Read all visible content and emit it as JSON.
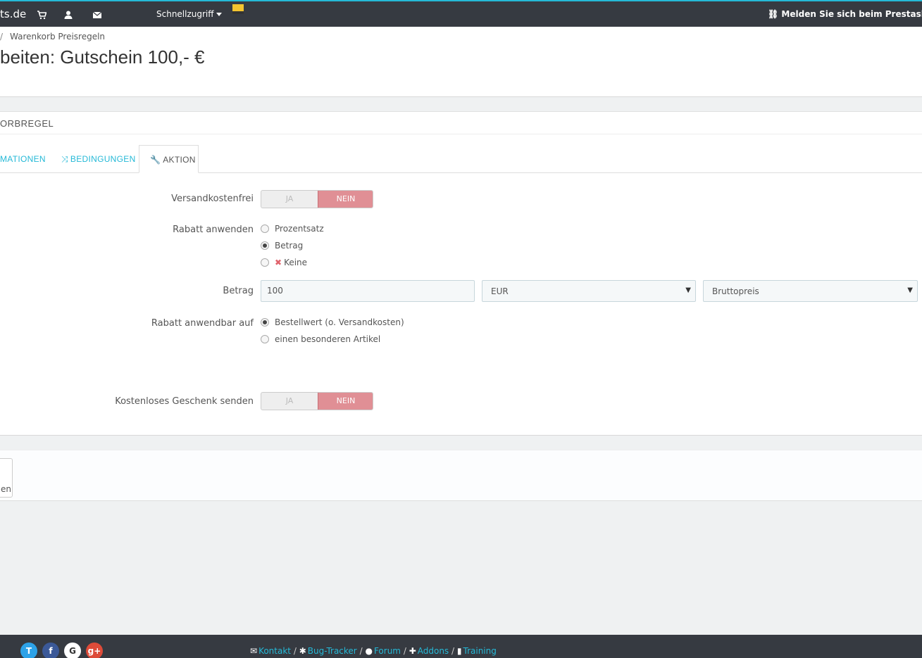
{
  "topbar": {
    "shop_name": "ts.de",
    "cart_icon": "shopping-cart-icon",
    "user_icon": "user-icon",
    "mail_icon": "envelope-icon",
    "quick_access": "Schnellzugriff",
    "login_notice": "Melden Sie sich beim Prestashop Ma"
  },
  "breadcrumb": {
    "separator": "/",
    "current": "Warenkorb Preisregeln"
  },
  "page_title": "beiten: Gutschein 100,- €",
  "panel": {
    "heading": "ORBREGEL",
    "tabs": [
      {
        "label": "MATIONEN",
        "icon": "info-icon"
      },
      {
        "label": "BEDINGUNGEN",
        "icon": "random-icon"
      },
      {
        "label": "AKTION",
        "icon": "wrench-icon"
      }
    ]
  },
  "form": {
    "free_shipping": {
      "label": "Versandkostenfrei",
      "yes": "JA",
      "no": "NEIN",
      "value": "NEIN"
    },
    "apply_discount": {
      "label": "Rabatt anwenden",
      "options": [
        {
          "label": "Prozentsatz",
          "checked": false
        },
        {
          "label": "Betrag",
          "checked": true
        },
        {
          "label": "Keine",
          "checked": false,
          "icon": "times-icon"
        }
      ]
    },
    "amount": {
      "label": "Betrag",
      "value": "100",
      "currency": "EUR",
      "tax": "Bruttopreis"
    },
    "apply_to": {
      "label": "Rabatt anwendbar auf",
      "options": [
        {
          "label": "Bestellwert (o. Versandkosten)",
          "checked": true
        },
        {
          "label": "einen besonderen Artikel",
          "checked": false
        }
      ]
    },
    "free_gift": {
      "label": "Kostenloses Geschenk senden",
      "yes": "JA",
      "no": "NEIN",
      "value": "NEIN"
    }
  },
  "footer_panel": {
    "cancel_label": "en"
  },
  "footer": {
    "social": [
      "T",
      "f",
      "G",
      "g+"
    ],
    "social_colors": [
      "#2da2e8",
      "#3b5998",
      "#ffffff",
      "#dd4b39"
    ],
    "links": [
      "Kontakt",
      "Bug-Tracker",
      "Forum",
      "Addons",
      "Training"
    ],
    "separator": "/"
  },
  "colors": {
    "accent": "#25b9d7",
    "topbar": "#363a41",
    "switch_no": "#e08f95"
  }
}
